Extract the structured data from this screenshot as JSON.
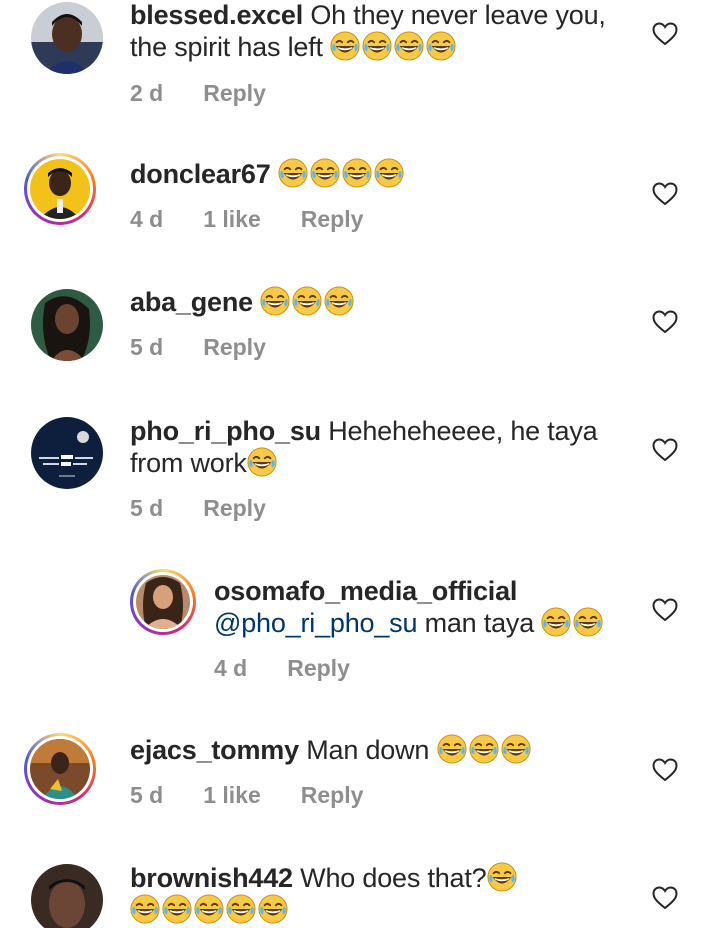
{
  "comments": [
    {
      "username": "blessed.excel",
      "text_line1": "Oh they never leave you,",
      "text_line2": "the spirit has left",
      "emoji_count": 4,
      "time": "2 d",
      "likes": "",
      "reply": "Reply"
    },
    {
      "username": "donclear67",
      "text": "",
      "emoji_count": 4,
      "time": "4 d",
      "likes": "1 like",
      "reply": "Reply"
    },
    {
      "username": "aba_gene",
      "text": "",
      "emoji_count": 3,
      "time": "5 d",
      "likes": "",
      "reply": "Reply"
    },
    {
      "username": "pho_ri_pho_su",
      "text_line1": "Heheheheeee, he taya",
      "text_line2": "from work",
      "emoji_count": 1,
      "time": "5 d",
      "likes": "",
      "reply": "Reply"
    },
    {
      "username": "osomafo_media_official",
      "mention": "@pho_ri_pho_su",
      "text": "man taya",
      "emoji_count": 2,
      "time": "4 d",
      "likes": "",
      "reply": "Reply"
    },
    {
      "username": "ejacs_tommy",
      "text": "Man down",
      "emoji_count": 3,
      "time": "5 d",
      "likes": "1 like",
      "reply": "Reply"
    },
    {
      "username": "brownish442",
      "text": "Who does that?",
      "emoji_count_line1": 1,
      "emoji_count_line2": 5
    }
  ],
  "colors": {
    "text": "#262626",
    "meta": "#8e8e8e",
    "mention": "#00376b"
  },
  "icons": {
    "heart": "heart-outline-icon",
    "emoji": "face-with-tears-of-joy-emoji"
  }
}
